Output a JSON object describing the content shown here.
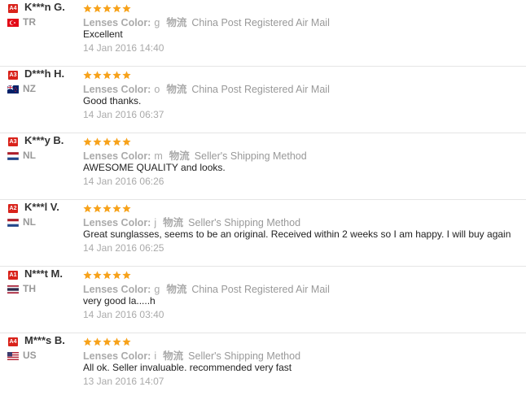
{
  "reviews": [
    {
      "level": "A4",
      "name": "K***n G.",
      "country": "TR",
      "flag": "turkey-flag-icon",
      "stars": 5,
      "attr_label": "Lenses Color:",
      "attr_value": "g",
      "shipping_icon": "物流",
      "shipping": "China Post Registered Air Mail",
      "comment": "Excellent",
      "date": "14 Jan 2016 14:40"
    },
    {
      "level": "A3",
      "name": "D***h H.",
      "country": "NZ",
      "flag": "new-zealand-flag-icon",
      "stars": 5,
      "attr_label": "Lenses Color:",
      "attr_value": "o",
      "shipping_icon": "物流",
      "shipping": "China Post Registered Air Mail",
      "comment": "Good thanks.",
      "date": "14 Jan 2016 06:37"
    },
    {
      "level": "A3",
      "name": "K***y B.",
      "country": "NL",
      "flag": "netherlands-flag-icon",
      "stars": 5,
      "attr_label": "Lenses Color:",
      "attr_value": "m",
      "shipping_icon": "物流",
      "shipping": "Seller's Shipping Method",
      "comment": "AWESOME QUALITY and looks.",
      "date": "14 Jan 2016 06:26"
    },
    {
      "level": "A2",
      "name": "K***l V.",
      "country": "NL",
      "flag": "netherlands-flag-icon",
      "stars": 5,
      "attr_label": "Lenses Color:",
      "attr_value": "j",
      "shipping_icon": "物流",
      "shipping": "Seller's Shipping Method",
      "comment": "Great sunglasses, seems to be an original. Received within 2 weeks so I am happy. I will buy again",
      "date": "14 Jan 2016 06:25"
    },
    {
      "level": "A1",
      "name": "N***t M.",
      "country": "TH",
      "flag": "thailand-flag-icon",
      "stars": 5,
      "attr_label": "Lenses Color:",
      "attr_value": "g",
      "shipping_icon": "物流",
      "shipping": "China Post Registered Air Mail",
      "comment": "very good la.....h",
      "date": "14 Jan 2016 03:40"
    },
    {
      "level": "A4",
      "name": "M***s B.",
      "country": "US",
      "flag": "usa-flag-icon",
      "stars": 5,
      "attr_label": "Lenses Color:",
      "attr_value": "i",
      "shipping_icon": "物流",
      "shipping": "Seller's Shipping Method",
      "comment": "All ok. Seller invaluable. recommended very fast",
      "date": "13 Jan 2016 14:07"
    }
  ],
  "colors": {
    "star": "#f7a21a",
    "badge": "#d9231b",
    "muted": "#aaaaaa"
  }
}
